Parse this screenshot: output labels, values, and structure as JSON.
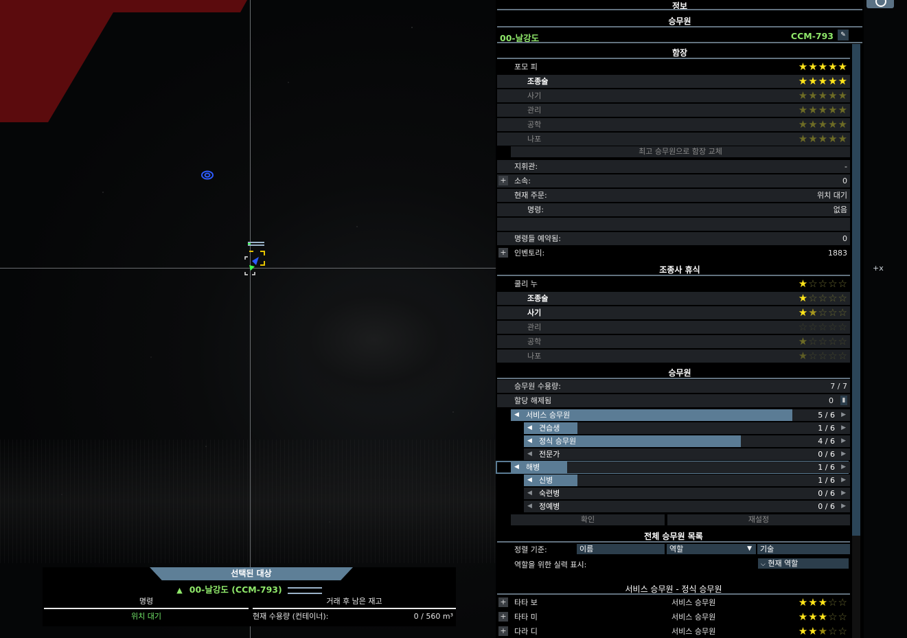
{
  "panel": {
    "title": "정보",
    "crew_header": "승무원",
    "ship_name": "00-날강도",
    "ship_code": "CCM-793",
    "ship_section": "함장",
    "captain": {
      "name": "포모 피",
      "stars": 5,
      "skills": [
        {
          "label": "조종술",
          "stars": 5,
          "bold": true
        },
        {
          "label": "사기",
          "stars": 5,
          "bold": false
        },
        {
          "label": "관리",
          "stars": 5,
          "bold": false
        },
        {
          "label": "공학",
          "stars": 5,
          "bold": false
        },
        {
          "label": "나포",
          "stars": 5,
          "bold": false
        }
      ],
      "replace_button": "최고 승무원으로 함장 교체"
    },
    "info_rows": [
      {
        "label": "지휘관:",
        "value": "-"
      },
      {
        "label": "소속:",
        "value": "0"
      },
      {
        "label": "현재 주문:",
        "value": "위치 대기"
      },
      {
        "label": "명령:",
        "value": "없음"
      },
      {
        "label": "명령들 예약됨:",
        "value": "0"
      },
      {
        "label": "인벤토리:",
        "value": "1883"
      }
    ],
    "pilot_section": "조종사 휴식",
    "pilot": {
      "name": "쿨리 누",
      "stars": 1,
      "skills": [
        {
          "label": "조종술",
          "stars": 1,
          "bold": true
        },
        {
          "label": "사기",
          "stars": 1.5,
          "bold": true
        },
        {
          "label": "관리",
          "stars": 0,
          "bold": false
        },
        {
          "label": "공학",
          "stars": 1,
          "bold": false
        },
        {
          "label": "나포",
          "stars": 0.5,
          "bold": false
        }
      ]
    },
    "crew_section": "승무원",
    "crew_capacity_label": "승무원 수용량:",
    "crew_capacity_value": "7 / 7",
    "unassigned_label": "할당 해제됨",
    "unassigned_value": "0",
    "roles": [
      {
        "name": "서비스 승무원",
        "count": "5 / 6",
        "fill": 0.83
      },
      {
        "name": "견습생",
        "count": "1 / 6",
        "fill": 0.17
      },
      {
        "name": "정식 승무원",
        "count": "4 / 6",
        "fill": 0.67
      },
      {
        "name": "전문가",
        "count": "0 / 6",
        "fill": 0
      },
      {
        "name": "해병",
        "count": "1 / 6",
        "fill": 0.17
      },
      {
        "name": "신병",
        "count": "1 / 6",
        "fill": 0.17
      },
      {
        "name": "숙련병",
        "count": "0 / 6",
        "fill": 0
      },
      {
        "name": "정예병",
        "count": "0 / 6",
        "fill": 0
      }
    ],
    "confirm_button": "확인",
    "reset_button": "재설정",
    "roster_section": "전체 승무원 목록",
    "sort_label": "정렬 기준:",
    "sort_options": [
      "이름",
      "역할",
      "기술"
    ],
    "skill_display_label": "역할을 위한 실력 표시:",
    "skill_display_value": "현재 역할",
    "roster_group": "서비스 승무원 - 정식 승무원",
    "roster": [
      {
        "name": "타타 보",
        "role": "서비스 승무원",
        "stars": 3
      },
      {
        "name": "타타 미",
        "role": "서비스 승무원",
        "stars": 3
      },
      {
        "name": "다라 디",
        "role": "서비스 승무원",
        "stars": 2.5
      }
    ]
  },
  "target": {
    "title": "선택된 대상",
    "name": "00-날강도 (CCM-793)",
    "col1_header": "명령",
    "col2_header": "거래 후 남은 재고",
    "order_value": "위치 대기",
    "capacity_label": "현재 수용량 (컨테이너):",
    "capacity_value": "0 / 560 m³"
  },
  "map": {
    "cursor_label": "+x"
  },
  "colors": {
    "accent_blue": "#5b7c95",
    "star_on": "#ffe41a",
    "name_green": "#8fe86a",
    "danger_red": "#5b0b0d"
  }
}
